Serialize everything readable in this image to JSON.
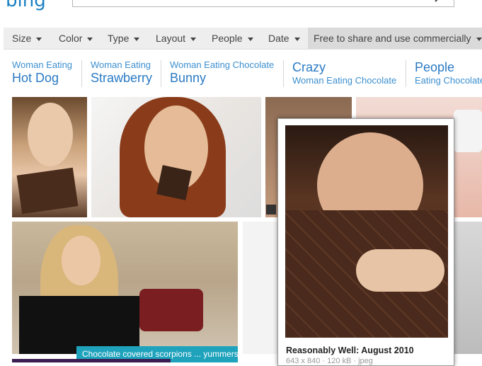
{
  "header": {
    "logo_text": "bing",
    "search_icon": "search-icon"
  },
  "filters": [
    {
      "label": "Size"
    },
    {
      "label": "Color"
    },
    {
      "label": "Type"
    },
    {
      "label": "Layout"
    },
    {
      "label": "People"
    },
    {
      "label": "Date"
    },
    {
      "label": "Free to share and use commercially"
    }
  ],
  "related": [
    {
      "small": "Woman Eating",
      "big": "Hot Dog"
    },
    {
      "small": "Woman Eating",
      "big": "Strawberry"
    },
    {
      "small": "Woman Eating Chocolate",
      "big": "Bunny"
    },
    {
      "big": "Crazy",
      "small": "Woman Eating Chocolate"
    },
    {
      "big": "People",
      "small": "Eating Chocolate"
    }
  ],
  "results": {
    "caption": "Chocolate covered scorpions ... yummers"
  },
  "hover": {
    "title": "Reasonably Well: August 2010",
    "meta": "643 x 840 · 120 kB · jpeg"
  }
}
